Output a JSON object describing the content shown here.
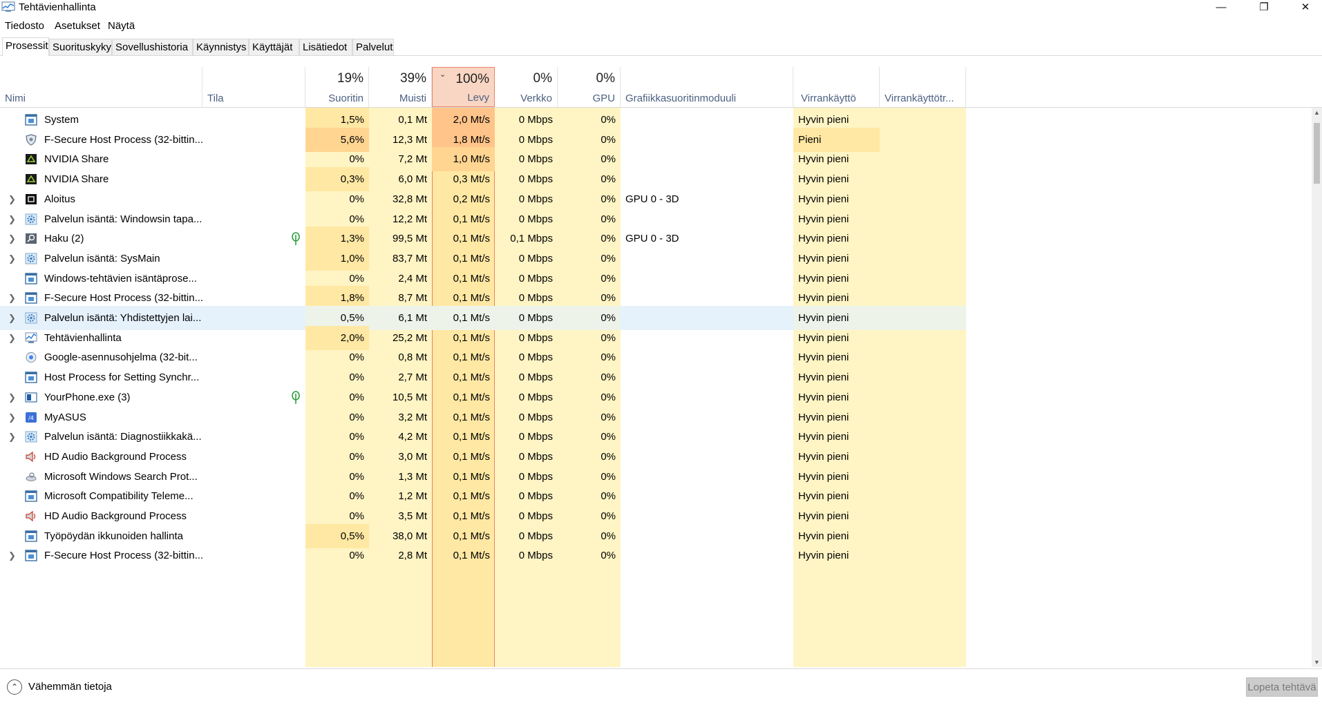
{
  "window": {
    "title": "Tehtävienhallinta",
    "minimize": "—",
    "restore": "❐",
    "close": "✕"
  },
  "menu": [
    "Tiedosto",
    "Asetukset",
    "Näytä"
  ],
  "tabs": [
    "Prosessit",
    "Suorituskyky",
    "Sovellushistoria",
    "Käynnistys",
    "Käyttäjät",
    "Lisätiedot",
    "Palvelut"
  ],
  "columns": {
    "name": "Nimi",
    "status": "Tila",
    "cpu": {
      "pct": "19%",
      "label": "Suoritin"
    },
    "memory": {
      "pct": "39%",
      "label": "Muisti"
    },
    "disk": {
      "pct": "100%",
      "label": "Levy"
    },
    "network": {
      "pct": "0%",
      "label": "Verkko"
    },
    "gpu": {
      "pct": "0%",
      "label": "GPU"
    },
    "gpu_engine": "Grafiikkasuoritinmoduuli",
    "power": "Virrankäyttö",
    "power_trend": "Virrankäyttötr..."
  },
  "colors": {
    "heat_light": "#fff4c4",
    "heat_mid": "#ffe8a3",
    "heat_strong": "#ffd591",
    "heat_orange": "#ffc48a",
    "disk_sorted": "#f9d6c3",
    "selected_row": "#e5f1fb",
    "header_label": "#4d6082",
    "leaf": "#2e9e3e"
  },
  "rows": [
    {
      "name": "System",
      "icon": "blue-app-icon",
      "expand": false,
      "leaf": false,
      "cpu": "1,5%",
      "mem": "0,1 Mt",
      "disk": "2,0 Mt/s",
      "net": "0 Mbps",
      "gpu": "0%",
      "engine": "",
      "power": "Hyvin pieni"
    },
    {
      "name": "F-Secure Host Process (32-bittin...",
      "icon": "shield-icon",
      "expand": false,
      "leaf": false,
      "cpu": "5,6%",
      "mem": "12,3 Mt",
      "disk": "1,8 Mt/s",
      "net": "0 Mbps",
      "gpu": "0%",
      "engine": "",
      "power": "Pieni"
    },
    {
      "name": "NVIDIA Share",
      "icon": "nvidia-icon",
      "expand": false,
      "leaf": false,
      "cpu": "0%",
      "mem": "7,2 Mt",
      "disk": "1,0 Mt/s",
      "net": "0 Mbps",
      "gpu": "0%",
      "engine": "",
      "power": "Hyvin pieni"
    },
    {
      "name": "NVIDIA Share",
      "icon": "nvidia-icon",
      "expand": false,
      "leaf": false,
      "cpu": "0,3%",
      "mem": "6,0 Mt",
      "disk": "0,3 Mt/s",
      "net": "0 Mbps",
      "gpu": "0%",
      "engine": "",
      "power": "Hyvin pieni"
    },
    {
      "name": "Aloitus",
      "icon": "start-icon",
      "expand": true,
      "leaf": false,
      "cpu": "0%",
      "mem": "32,8 Mt",
      "disk": "0,2 Mt/s",
      "net": "0 Mbps",
      "gpu": "0%",
      "engine": "GPU 0 - 3D",
      "power": "Hyvin pieni"
    },
    {
      "name": "Palvelun isäntä: Windowsin tapa...",
      "icon": "gear-icon",
      "expand": true,
      "leaf": false,
      "cpu": "0%",
      "mem": "12,2 Mt",
      "disk": "0,1 Mt/s",
      "net": "0 Mbps",
      "gpu": "0%",
      "engine": "",
      "power": "Hyvin pieni"
    },
    {
      "name": "Haku (2)",
      "icon": "search-icon",
      "expand": true,
      "leaf": true,
      "cpu": "1,3%",
      "mem": "99,5 Mt",
      "disk": "0,1 Mt/s",
      "net": "0,1 Mbps",
      "gpu": "0%",
      "engine": "GPU 0 - 3D",
      "power": "Hyvin pieni"
    },
    {
      "name": "Palvelun isäntä: SysMain",
      "icon": "gear-icon",
      "expand": true,
      "leaf": false,
      "cpu": "1,0%",
      "mem": "83,7 Mt",
      "disk": "0,1 Mt/s",
      "net": "0 Mbps",
      "gpu": "0%",
      "engine": "",
      "power": "Hyvin pieni"
    },
    {
      "name": "Windows-tehtävien isäntäprose...",
      "icon": "blue-app-icon",
      "expand": false,
      "leaf": false,
      "cpu": "0%",
      "mem": "2,4 Mt",
      "disk": "0,1 Mt/s",
      "net": "0 Mbps",
      "gpu": "0%",
      "engine": "",
      "power": "Hyvin pieni"
    },
    {
      "name": "F-Secure Host Process (32-bittin...",
      "icon": "blue-app-icon",
      "expand": true,
      "leaf": false,
      "cpu": "1,8%",
      "mem": "8,7 Mt",
      "disk": "0,1 Mt/s",
      "net": "0 Mbps",
      "gpu": "0%",
      "engine": "",
      "power": "Hyvin pieni"
    },
    {
      "name": "Palvelun isäntä: Yhdistettyjen lai...",
      "icon": "gear-icon",
      "expand": true,
      "leaf": false,
      "cpu": "0,5%",
      "mem": "6,1 Mt",
      "disk": "0,1 Mt/s",
      "net": "0 Mbps",
      "gpu": "0%",
      "engine": "",
      "power": "Hyvin pieni",
      "selected": true
    },
    {
      "name": "Tehtävienhallinta",
      "icon": "taskmgr-icon",
      "expand": true,
      "leaf": false,
      "cpu": "2,0%",
      "mem": "25,2 Mt",
      "disk": "0,1 Mt/s",
      "net": "0 Mbps",
      "gpu": "0%",
      "engine": "",
      "power": "Hyvin pieni"
    },
    {
      "name": "Google-asennusohjelma (32-bit...",
      "icon": "google-update-icon",
      "expand": false,
      "leaf": false,
      "cpu": "0%",
      "mem": "0,8 Mt",
      "disk": "0,1 Mt/s",
      "net": "0 Mbps",
      "gpu": "0%",
      "engine": "",
      "power": "Hyvin pieni"
    },
    {
      "name": "Host Process for Setting Synchr...",
      "icon": "blue-app-icon",
      "expand": false,
      "leaf": false,
      "cpu": "0%",
      "mem": "2,7 Mt",
      "disk": "0,1 Mt/s",
      "net": "0 Mbps",
      "gpu": "0%",
      "engine": "",
      "power": "Hyvin pieni"
    },
    {
      "name": "YourPhone.exe (3)",
      "icon": "phone-app-icon",
      "expand": true,
      "leaf": true,
      "cpu": "0%",
      "mem": "10,5 Mt",
      "disk": "0,1 Mt/s",
      "net": "0 Mbps",
      "gpu": "0%",
      "engine": "",
      "power": "Hyvin pieni"
    },
    {
      "name": "MyASUS",
      "icon": "myasus-icon",
      "expand": true,
      "leaf": false,
      "cpu": "0%",
      "mem": "3,2 Mt",
      "disk": "0,1 Mt/s",
      "net": "0 Mbps",
      "gpu": "0%",
      "engine": "",
      "power": "Hyvin pieni"
    },
    {
      "name": "Palvelun isäntä: Diagnostiikkakä...",
      "icon": "gear-icon",
      "expand": true,
      "leaf": false,
      "cpu": "0%",
      "mem": "4,2 Mt",
      "disk": "0,1 Mt/s",
      "net": "0 Mbps",
      "gpu": "0%",
      "engine": "",
      "power": "Hyvin pieni"
    },
    {
      "name": "HD Audio Background Process",
      "icon": "speaker-icon",
      "expand": false,
      "leaf": false,
      "cpu": "0%",
      "mem": "3,0 Mt",
      "disk": "0,1 Mt/s",
      "net": "0 Mbps",
      "gpu": "0%",
      "engine": "",
      "power": "Hyvin pieni"
    },
    {
      "name": "Microsoft Windows Search Prot...",
      "icon": "search-protocol-icon",
      "expand": false,
      "leaf": false,
      "cpu": "0%",
      "mem": "1,3 Mt",
      "disk": "0,1 Mt/s",
      "net": "0 Mbps",
      "gpu": "0%",
      "engine": "",
      "power": "Hyvin pieni"
    },
    {
      "name": "Microsoft Compatibility Teleme...",
      "icon": "blue-app-icon",
      "expand": false,
      "leaf": false,
      "cpu": "0%",
      "mem": "1,2 Mt",
      "disk": "0,1 Mt/s",
      "net": "0 Mbps",
      "gpu": "0%",
      "engine": "",
      "power": "Hyvin pieni"
    },
    {
      "name": "HD Audio Background Process",
      "icon": "speaker-icon",
      "expand": false,
      "leaf": false,
      "cpu": "0%",
      "mem": "3,5 Mt",
      "disk": "0,1 Mt/s",
      "net": "0 Mbps",
      "gpu": "0%",
      "engine": "",
      "power": "Hyvin pieni"
    },
    {
      "name": "Työpöydän ikkunoiden hallinta",
      "icon": "blue-app-icon",
      "expand": false,
      "leaf": false,
      "cpu": "0,5%",
      "mem": "38,0 Mt",
      "disk": "0,1 Mt/s",
      "net": "0 Mbps",
      "gpu": "0%",
      "engine": "",
      "power": "Hyvin pieni"
    },
    {
      "name": "F-Secure Host Process (32-bittin...",
      "icon": "blue-app-icon",
      "expand": true,
      "leaf": false,
      "cpu": "0%",
      "mem": "2,8 Mt",
      "disk": "0,1 Mt/s",
      "net": "0 Mbps",
      "gpu": "0%",
      "engine": "",
      "power": "Hyvin pieni"
    }
  ],
  "footer": {
    "fewer_details": "Vähemmän tietoja",
    "end_task": "Lopeta tehtävä"
  }
}
